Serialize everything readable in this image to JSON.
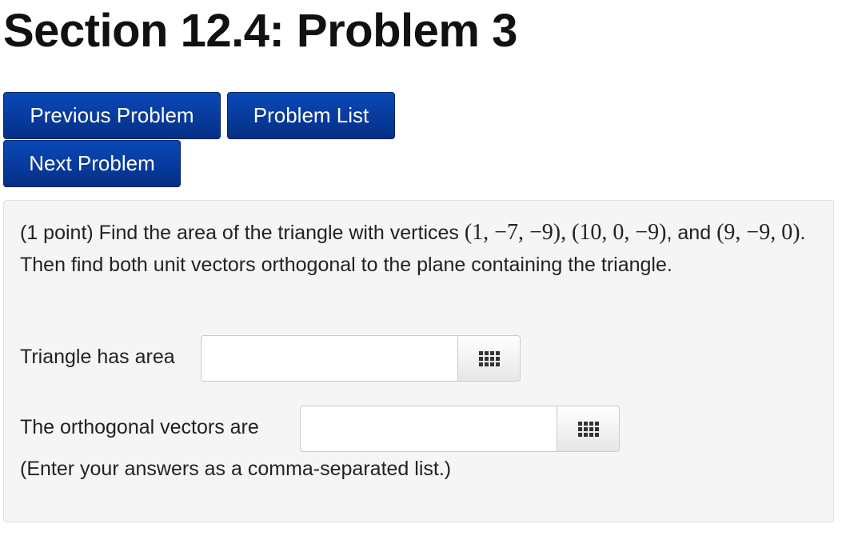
{
  "page": {
    "title": "Section 12.4: Problem 3"
  },
  "nav": {
    "previous_label": "Previous Problem",
    "list_label": "Problem List",
    "next_label": "Next Problem"
  },
  "problem": {
    "points": "(1 point)",
    "text_before": "Find the area of the triangle with vertices",
    "vertex1": "(1, −7, −9)",
    "vertex2": "(10, 0, −9)",
    "and_word": "and",
    "vertex3": "(9, −9, 0)",
    "text_after": "Then find both unit vectors orthogonal to the plane containing the triangle.",
    "area_label": "Triangle has area",
    "area_value": "",
    "vectors_label": "The orthogonal vectors are",
    "vectors_value": "",
    "hint": "(Enter your answers as a comma-separated list.)"
  },
  "icons": {
    "equation_editor": "equation-editor-icon"
  },
  "colors": {
    "nav_button_bg": "#063a9a",
    "nav_button_text": "#ffffff",
    "problem_box_bg": "#f5f5f5"
  }
}
